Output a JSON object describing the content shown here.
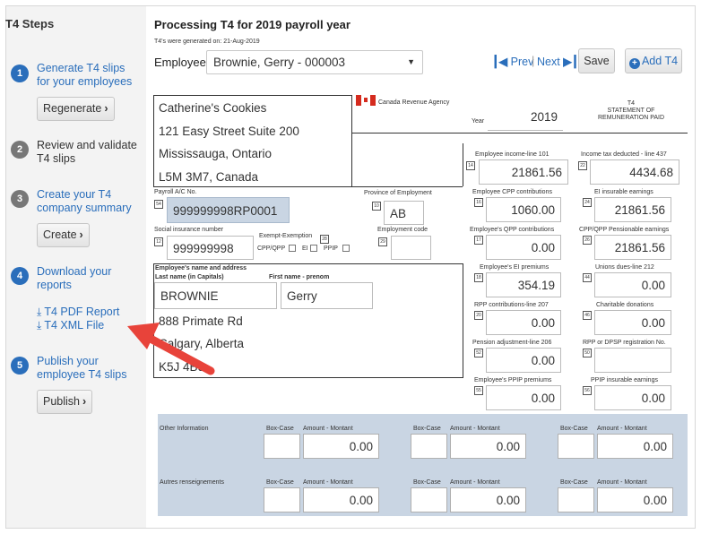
{
  "sidebar": {
    "title": "T4 Steps",
    "steps": [
      {
        "num": "1",
        "text_line1": "Generate T4 slips",
        "text_line2": "for your employees",
        "button": "Regenerate"
      },
      {
        "num": "2",
        "text_line1": "Review and validate",
        "text_line2": "T4 slips"
      },
      {
        "num": "3",
        "text_line1": "Create your T4",
        "text_line2": "company summary",
        "button": "Create"
      },
      {
        "num": "4",
        "text_line1": "Download your",
        "text_line2": "reports",
        "links": [
          "T4 PDF Report",
          "T4 XML File"
        ]
      },
      {
        "num": "5",
        "text_line1": "Publish your",
        "text_line2": "employee T4 slips",
        "button": "Publish"
      }
    ]
  },
  "header": {
    "title": "Processing T4 for 2019 payroll year",
    "generated": "T4's were generated on: 21-Aug-2019",
    "employee_label": "Employee",
    "employee_value": "Brownie, Gerry - 000003",
    "prev": "Prev",
    "next": "Next",
    "save": "Save",
    "add": "Add T4"
  },
  "slip": {
    "company": [
      "Catherine's Cookies",
      "121 Easy Street Suite 200",
      "Mississauga, Ontario",
      "L5M 3M7, Canada"
    ],
    "agency": "Canada Revenue Agency",
    "year_label": "Year",
    "year": "2019",
    "form_title": "T4",
    "form_sub1": "STATEMENT OF",
    "form_sub2": "REMUNERATION PAID",
    "payroll_label": "Payroll A/C No.",
    "payroll_value": "999999998RP0001",
    "province_label": "Province of Employment",
    "province_value": "AB",
    "sin_label": "Social insurance number",
    "sin_value": "999999998",
    "exempt_label": "Exempt-Exemption",
    "exempt_cpp": "CPP/QPP",
    "exempt_ei": "EI",
    "exempt_ppip": "PPIP",
    "empcode_label": "Employment code",
    "name_header": "Employee's name and address",
    "last_label": "Last name (in Capitals)",
    "first_label": "First name - prenom",
    "last_value": "BROWNIE",
    "first_value": "Gerry",
    "address": [
      "888 Primate Rd",
      "Calgary, Alberta",
      "K5J 4B9"
    ],
    "fields": [
      {
        "label": "Employee income-line 101",
        "value": "21861.56",
        "tag": "14"
      },
      {
        "label": "Income tax deducted - line 437",
        "value": "4434.68",
        "tag": "22"
      },
      {
        "label": "Employee CPP contributions",
        "value": "1060.00",
        "tag": "16"
      },
      {
        "label": "EI insurable earnings",
        "value": "21861.56",
        "tag": "24"
      },
      {
        "label": "Employee's QPP contributions",
        "value": "0.00",
        "tag": "17"
      },
      {
        "label": "CPP/QPP Pensionable earnings",
        "value": "21861.56",
        "tag": "26"
      },
      {
        "label": "Employee's EI premiums",
        "value": "354.19",
        "tag": "18"
      },
      {
        "label": "Unions dues-line 212",
        "value": "0.00",
        "tag": "44"
      },
      {
        "label": "RPP contributions-line 207",
        "value": "0.00",
        "tag": "20"
      },
      {
        "label": "Charitable donations",
        "value": "0.00",
        "tag": "46"
      },
      {
        "label": "Pension adjustment-line 206",
        "value": "0.00",
        "tag": "52"
      },
      {
        "label": "RPP or DPSP registration No.",
        "value": "",
        "tag": "50"
      },
      {
        "label": "Employee's PPIP premiums",
        "value": "0.00",
        "tag": "55"
      },
      {
        "label": "PPIP insurable earnings",
        "value": "0.00",
        "tag": "56"
      }
    ],
    "tags": {
      "payroll": "54",
      "province": "10",
      "sin": "12",
      "exempt": "28",
      "empcode": "29"
    }
  },
  "other_info": {
    "label1": "Other Information",
    "label2": "Autres renseignements",
    "box_label": "Box-Case",
    "amount_label": "Amount - Montant",
    "values": [
      "0.00",
      "0.00",
      "0.00",
      "0.00",
      "0.00",
      "0.00"
    ]
  },
  "colors": {
    "link": "#2a6ebb",
    "arrow": "#e8433a",
    "shaded": "#c9d5e3"
  }
}
